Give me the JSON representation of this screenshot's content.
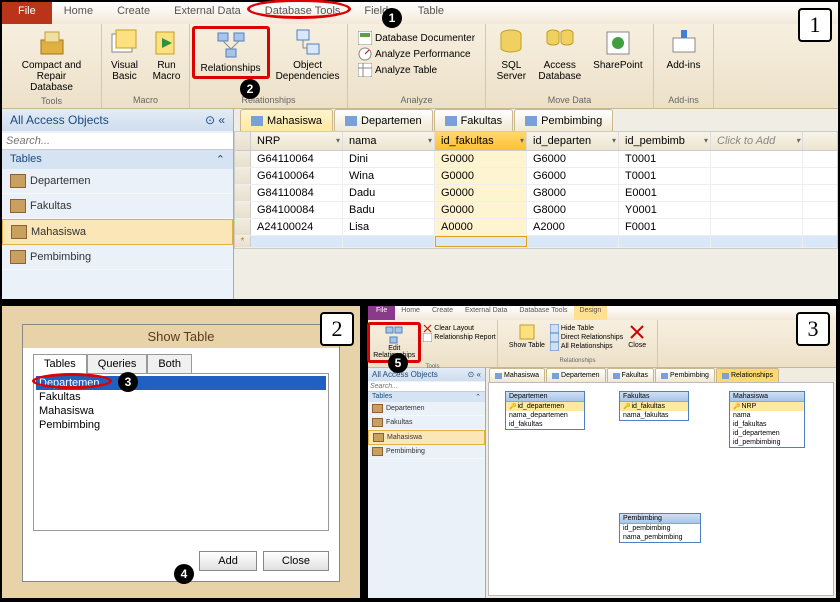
{
  "panel1": {
    "menu": {
      "file": "File",
      "home": "Home",
      "create": "Create",
      "external": "External Data",
      "dbtools": "Database Tools",
      "fields": "Fields",
      "table": "Table"
    },
    "groups": {
      "tools": "Tools",
      "macro": "Macro",
      "relationships": "Relationships",
      "analyze": "Analyze",
      "movedata": "Move Data",
      "addins": "Add-ins"
    },
    "btns": {
      "compact": "Compact and Repair Database",
      "vb": "Visual Basic",
      "runmacro": "Run Macro",
      "relationships": "Relationships",
      "objdep": "Object Dependencies",
      "dbdoc": "Database Documenter",
      "analyzeperf": "Analyze Performance",
      "analyzetable": "Analyze Table",
      "sqlserver": "SQL Server",
      "accessdb": "Access Database",
      "sharepoint": "SharePoint",
      "addins": "Add-ins"
    },
    "nav": {
      "title": "All Access Objects",
      "search": "Search...",
      "group": "Tables",
      "items": [
        "Departemen",
        "Fakultas",
        "Mahasiswa",
        "Pembimbing"
      ]
    },
    "tabs": [
      "Mahasiswa",
      "Departemen",
      "Fakultas",
      "Pembimbing"
    ],
    "cols": [
      "NRP",
      "nama",
      "id_fakultas",
      "id_departen",
      "id_pembimb",
      "Click to Add"
    ],
    "rows": [
      [
        "G64110064",
        "Dini",
        "G0000",
        "G6000",
        "T0001"
      ],
      [
        "G64100064",
        "Wina",
        "G0000",
        "G6000",
        "T0001"
      ],
      [
        "G84110084",
        "Dadu",
        "G0000",
        "G8000",
        "E0001"
      ],
      [
        "G84100084",
        "Badu",
        "G0000",
        "G8000",
        "Y0001"
      ],
      [
        "A24100024",
        "Lisa",
        "A0000",
        "A2000",
        "F0001"
      ]
    ]
  },
  "panel2": {
    "title": "Show Table",
    "tabs": [
      "Tables",
      "Queries",
      "Both"
    ],
    "list": [
      "Departemen",
      "Fakultas",
      "Mahasiswa",
      "Pembimbing"
    ],
    "add": "Add",
    "close": "Close"
  },
  "panel3": {
    "menu": {
      "file": "File",
      "home": "Home",
      "create": "Create",
      "external": "External Data",
      "dbtools": "Database Tools",
      "design": "Design"
    },
    "btns": {
      "edit": "Edit Relationships",
      "clear": "Clear Layout",
      "relreport": "Relationship Report",
      "show": "Show Table",
      "hide": "Hide Table",
      "direct": "Direct Relationships",
      "all": "All Relationships",
      "close": "Close"
    },
    "groups": {
      "tools": "Tools",
      "relationships": "Relationships"
    },
    "nav": {
      "title": "All Access Objects",
      "search": "Search...",
      "group": "Tables",
      "items": [
        "Departemen",
        "Fakultas",
        "Mahasiswa",
        "Pembimbing"
      ]
    },
    "tabs": [
      "Mahasiswa",
      "Departemen",
      "Fakultas",
      "Pembimbing",
      "Relationships"
    ],
    "tables": {
      "Departemen": [
        "id_departemen",
        "nama_departemen",
        "id_fakultas"
      ],
      "Fakultas": [
        "id_fakultas",
        "nama_fakultas"
      ],
      "Mahasiswa": [
        "NRP",
        "nama",
        "id_fakultas",
        "id_departemen",
        "id_pembimbing"
      ],
      "Pembimbing": [
        "id_pembimbing",
        "nama_pembimbing"
      ]
    }
  }
}
